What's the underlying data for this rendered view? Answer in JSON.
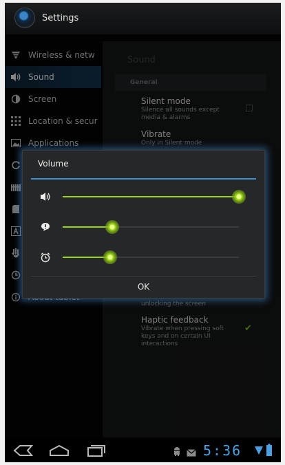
{
  "action_bar": {
    "title": "Settings"
  },
  "sidebar": {
    "items": [
      {
        "label": "Wireless & netw",
        "icon": "wifi-icon"
      },
      {
        "label": "Sound",
        "icon": "speaker-icon",
        "active": true
      },
      {
        "label": "Screen",
        "icon": "screen-icon"
      },
      {
        "label": "Location & secur",
        "icon": "grid-icon"
      },
      {
        "label": "Applications",
        "icon": "apps-icon"
      },
      {
        "label": "",
        "icon": "sync-icon"
      },
      {
        "label": "",
        "icon": "privacy-icon"
      },
      {
        "label": "",
        "icon": "storage-icon"
      },
      {
        "label": "",
        "icon": "language-icon"
      },
      {
        "label": "",
        "icon": "accessibility-icon"
      },
      {
        "label": "",
        "icon": "clock-icon"
      },
      {
        "label": "About tablet",
        "icon": "info-icon"
      }
    ]
  },
  "pane": {
    "title": "Sound",
    "category": "General",
    "silent_mode": {
      "title": "Silent mode",
      "summary": "Silence all sounds except media & alarms"
    },
    "vibrate": {
      "title": "Vibrate",
      "summary": "Only in Silent mode"
    },
    "screen_lock": {
      "summary": "unlocking the screen"
    },
    "haptic": {
      "title": "Haptic feedback",
      "summary": "Vibrate when pressing soft keys and on certain UI interactions"
    }
  },
  "dialog": {
    "title": "Volume",
    "sliders": [
      {
        "icon": "speaker-icon",
        "value": 1.0
      },
      {
        "icon": "notification-icon",
        "value": 0.28
      },
      {
        "icon": "alarm-clock-icon",
        "value": 0.27
      }
    ],
    "ok_label": "OK"
  },
  "system_bar": {
    "time": "5:36"
  },
  "colors": {
    "accent_blue": "#3f8fd6",
    "slider_green": "#9ed219",
    "check_green": "#7fb81d"
  }
}
